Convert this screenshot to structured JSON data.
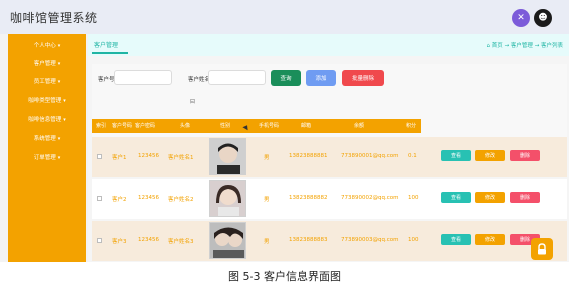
{
  "app": {
    "title": "咖啡馆管理系统"
  },
  "header": {
    "accent_color": "#7c5bd9",
    "user_icon": "user-icon",
    "theme_icon": "theme-icon"
  },
  "sidebar": {
    "bg_color": "#f3a200",
    "items": [
      {
        "label": "个人中心"
      },
      {
        "label": "客户管理"
      },
      {
        "label": "员工管理"
      },
      {
        "label": "咖啡类型管理"
      },
      {
        "label": "咖啡信息管理"
      },
      {
        "label": "系统管理"
      },
      {
        "label": "订单管理"
      }
    ]
  },
  "tabs": {
    "active": "客户管理"
  },
  "breadcrumb": {
    "text": "⌂ 首页 → 客户管理 → 客户列表"
  },
  "search": {
    "field1_label": "客户号",
    "field1_value": "",
    "field2_label": "客户姓名",
    "field2_value": "",
    "search_label": "查询",
    "add_label": "添加",
    "batch_delete_label": "批量删除",
    "tiny_text": "曰"
  },
  "table": {
    "columns": [
      "索引",
      "客户号码",
      "客户密码",
      "头像",
      "性别",
      "手机号码",
      "邮箱",
      "余额",
      "积分",
      "操作"
    ],
    "rows": [
      {
        "customer_no": "客户1",
        "password": "123456",
        "name": "客户姓名1",
        "gender": "男",
        "phone": "13823888881",
        "email": "773890001@qq.com",
        "points": "0.1"
      },
      {
        "customer_no": "客户2",
        "password": "123456",
        "name": "客户姓名2",
        "gender": "男",
        "phone": "13823888882",
        "email": "773890002@qq.com",
        "points": "100"
      },
      {
        "customer_no": "客户3",
        "password": "123456",
        "name": "客户姓名3",
        "gender": "男",
        "phone": "13823888883",
        "email": "773890003@qq.com",
        "points": "100"
      }
    ],
    "actions": {
      "view": "查看",
      "edit": "修改",
      "delete": "删除"
    }
  },
  "caption": {
    "text": "图 5-3 客户信息界面图"
  }
}
